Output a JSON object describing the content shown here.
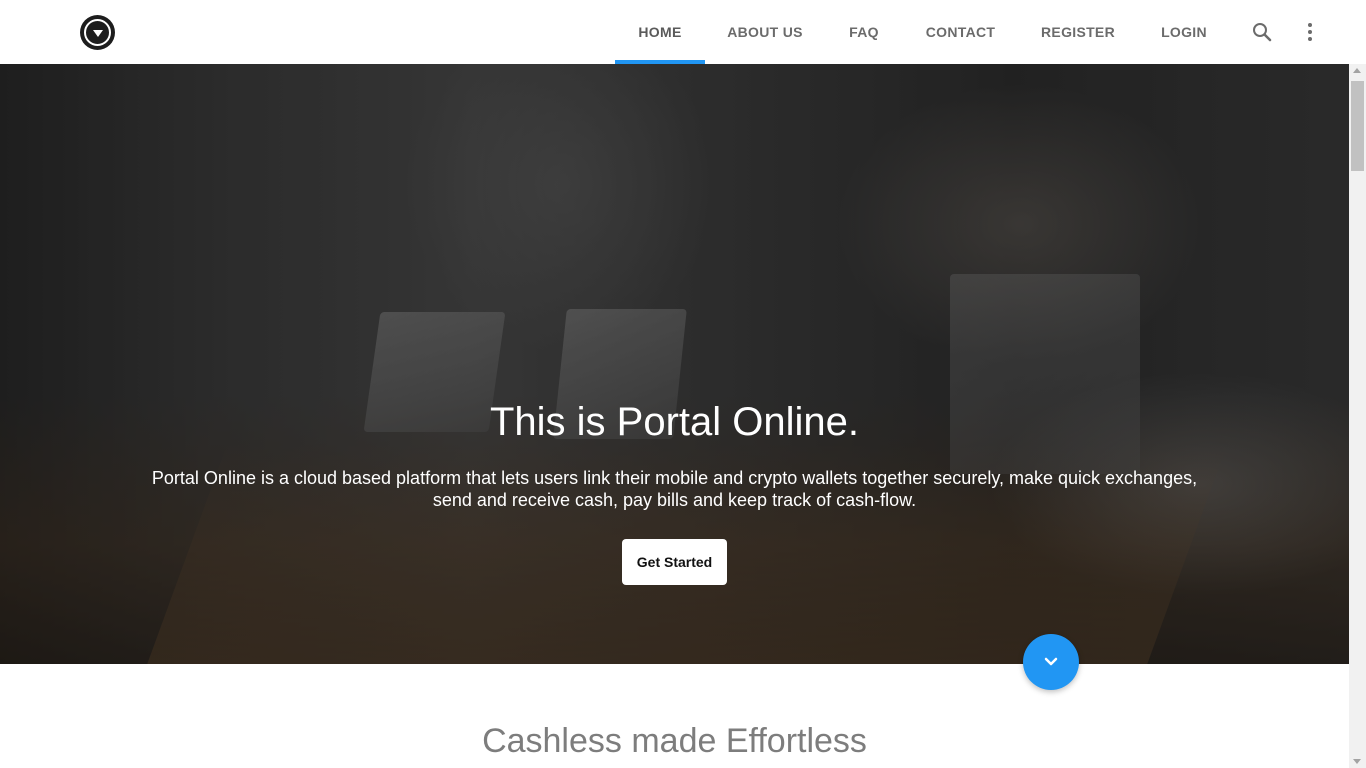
{
  "header": {
    "logo_icon": "dropdown-circle-logo",
    "nav": {
      "home": "HOME",
      "about": "ABOUT US",
      "faq": "FAQ",
      "contact": "CONTACT",
      "register": "REGISTER",
      "login": "LOGIN"
    },
    "active_tab": "HOME",
    "search_icon": "search-icon",
    "menu_icon": "more-vertical-icon"
  },
  "hero": {
    "title": "This is Portal Online.",
    "description_line1": "Portal Online is a cloud based platform that lets users link their mobile and crypto wallets together securely, make quick exchanges,",
    "description_line2": "send and receive cash, pay bills and keep track of cash-flow.",
    "cta_label": "Get Started",
    "scroll_button_icon": "chevron-down-icon"
  },
  "section": {
    "title": "Cashless made Effortless"
  },
  "colors": {
    "accent": "#2196f3",
    "nav_text": "#6b6b6b",
    "section_title": "#7d7d7d"
  }
}
